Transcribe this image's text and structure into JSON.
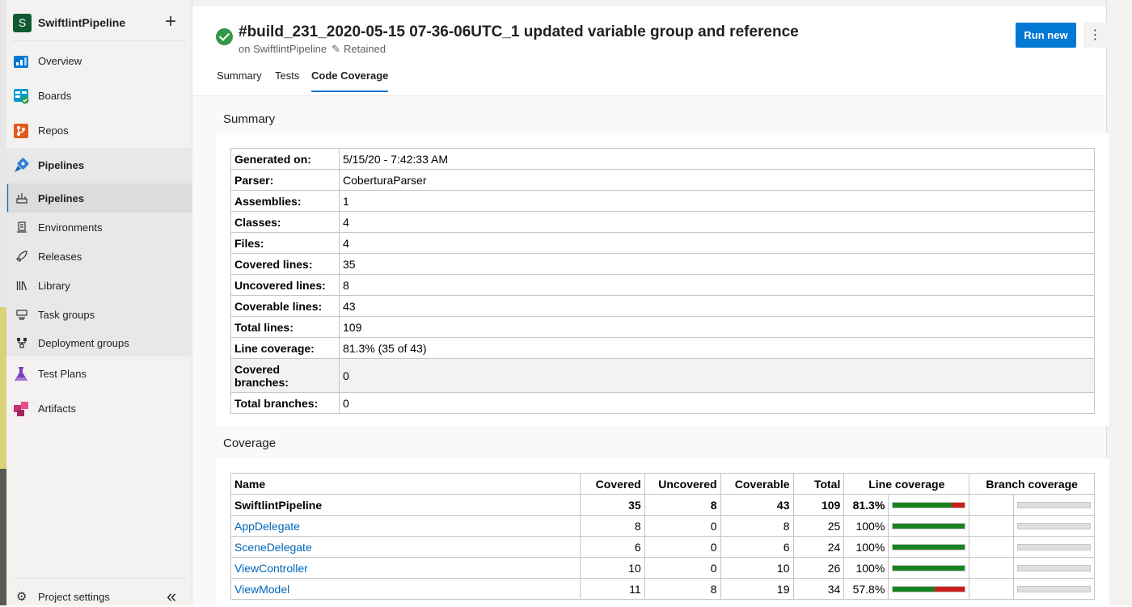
{
  "project": {
    "initial": "S",
    "name": "SwiftlintPipeline"
  },
  "nav": {
    "overview": "Overview",
    "boards": "Boards",
    "repos": "Repos",
    "pipelines_group": "Pipelines",
    "pipelines": "Pipelines",
    "environments": "Environments",
    "releases": "Releases",
    "library": "Library",
    "task_groups": "Task groups",
    "deployment_groups": "Deployment groups",
    "test_plans": "Test Plans",
    "artifacts": "Artifacts",
    "project_settings": "Project settings"
  },
  "header": {
    "title": "#build_231_2020-05-15 07-36-06UTC_1 updated variable group and reference",
    "subtitle_prefix": "on SwiftlintPipeline",
    "retained": "Retained",
    "run_new": "Run new",
    "more": "⋮"
  },
  "tabs": [
    "Summary",
    "Tests",
    "Code Coverage"
  ],
  "summary_section": {
    "label": "Summary",
    "rows": [
      {
        "key": "Generated on:",
        "value": "5/15/20 - 7:42:33 AM"
      },
      {
        "key": "Parser:",
        "value": "CoberturaParser"
      },
      {
        "key": "Assemblies:",
        "value": "1"
      },
      {
        "key": "Classes:",
        "value": "4"
      },
      {
        "key": "Files:",
        "value": "4"
      },
      {
        "key": "Covered lines:",
        "value": "35"
      },
      {
        "key": "Uncovered lines:",
        "value": "8"
      },
      {
        "key": "Coverable lines:",
        "value": "43"
      },
      {
        "key": "Total lines:",
        "value": "109"
      },
      {
        "key": "Line coverage:",
        "value": "81.3% (35 of 43)"
      },
      {
        "key": "Covered branches:",
        "value": "0"
      },
      {
        "key": "Total branches:",
        "value": "0"
      }
    ]
  },
  "coverage_section": {
    "label": "Coverage",
    "headers": [
      "Name",
      "Covered",
      "Uncovered",
      "Coverable",
      "Total",
      "Line coverage",
      "Branch coverage"
    ],
    "rows": [
      {
        "name": "SwiftlintPipeline",
        "covered": "35",
        "uncovered": "8",
        "coverable": "43",
        "total": "109",
        "pct": "81.3%",
        "fraction": 0.813
      },
      {
        "name": "AppDelegate",
        "covered": "8",
        "uncovered": "0",
        "coverable": "8",
        "total": "25",
        "pct": "100%",
        "fraction": 1.0
      },
      {
        "name": "SceneDelegate",
        "covered": "6",
        "uncovered": "0",
        "coverable": "6",
        "total": "24",
        "pct": "100%",
        "fraction": 1.0
      },
      {
        "name": "ViewController",
        "covered": "10",
        "uncovered": "0",
        "coverable": "10",
        "total": "26",
        "pct": "100%",
        "fraction": 1.0
      },
      {
        "name": "ViewModel",
        "covered": "11",
        "uncovered": "8",
        "coverable": "19",
        "total": "34",
        "pct": "57.8%",
        "fraction": 0.578
      }
    ]
  },
  "colors": {
    "accent": "#0078d4",
    "covered": "#17831f",
    "uncovered": "#cc1d1d",
    "success": "#339947"
  }
}
